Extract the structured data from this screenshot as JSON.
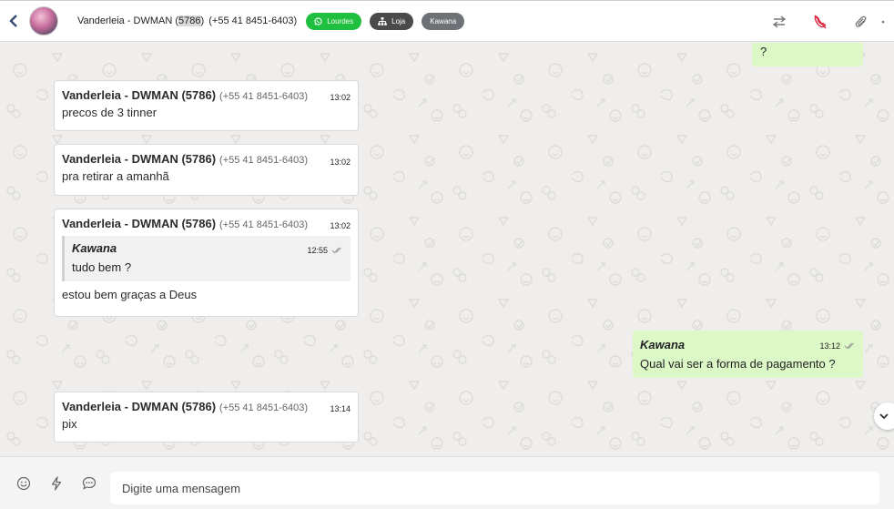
{
  "header": {
    "contact_name": "Vanderleia - DWMAN (",
    "contact_id": "5786",
    "contact_close": ")",
    "contact_phone": "(+55 41 8451-6403)",
    "tags": [
      {
        "label": "Lourdes",
        "color": "#1fbf3f",
        "icon": "whatsapp-icon"
      },
      {
        "label": "Loja",
        "color": "#4a4a4a",
        "icon": "sitemap-icon"
      },
      {
        "label": "Kawana",
        "color": "#6e7277",
        "icon": ""
      }
    ],
    "icons": [
      "transfer-icon",
      "end-call-icon",
      "attach-icon",
      "more-icon"
    ]
  },
  "messages": [
    {
      "type": "out-partial",
      "text": "?"
    },
    {
      "type": "in",
      "sender": "Vanderleia - DWMAN (5786)",
      "phone": "(+55 41 8451-6403)",
      "time": "13:02",
      "text": "precos de 3 tinner"
    },
    {
      "type": "in",
      "sender": "Vanderleia - DWMAN (5786)",
      "phone": "(+55 41 8451-6403)",
      "time": "13:02",
      "text": "pra retirar a amanhã"
    },
    {
      "type": "in",
      "sender": "Vanderleia - DWMAN (5786)",
      "phone": "(+55 41 8451-6403)",
      "time": "13:02",
      "quote": {
        "name": "Kawana",
        "time": "12:55",
        "text": "tudo bem ?"
      },
      "text": "estou bem graças a Deus"
    },
    {
      "type": "out",
      "sender": "Kawana",
      "time": "13:12",
      "text": "Qual vai ser a forma de pagamento ?"
    },
    {
      "type": "in",
      "sender": "Vanderleia - DWMAN (5786)",
      "phone": "(+55 41 8451-6403)",
      "time": "13:14",
      "text": "pix"
    }
  ],
  "composer": {
    "placeholder": "Digite uma mensagem",
    "icons": [
      "emoji-icon",
      "quick-reply-icon",
      "chat-template-icon"
    ]
  },
  "colors": {
    "outgoing_bubble": "#dcf8c6",
    "incoming_bubble": "#ffffff",
    "tag_green": "#1fbf3f",
    "end_call_red": "#d9243c"
  }
}
